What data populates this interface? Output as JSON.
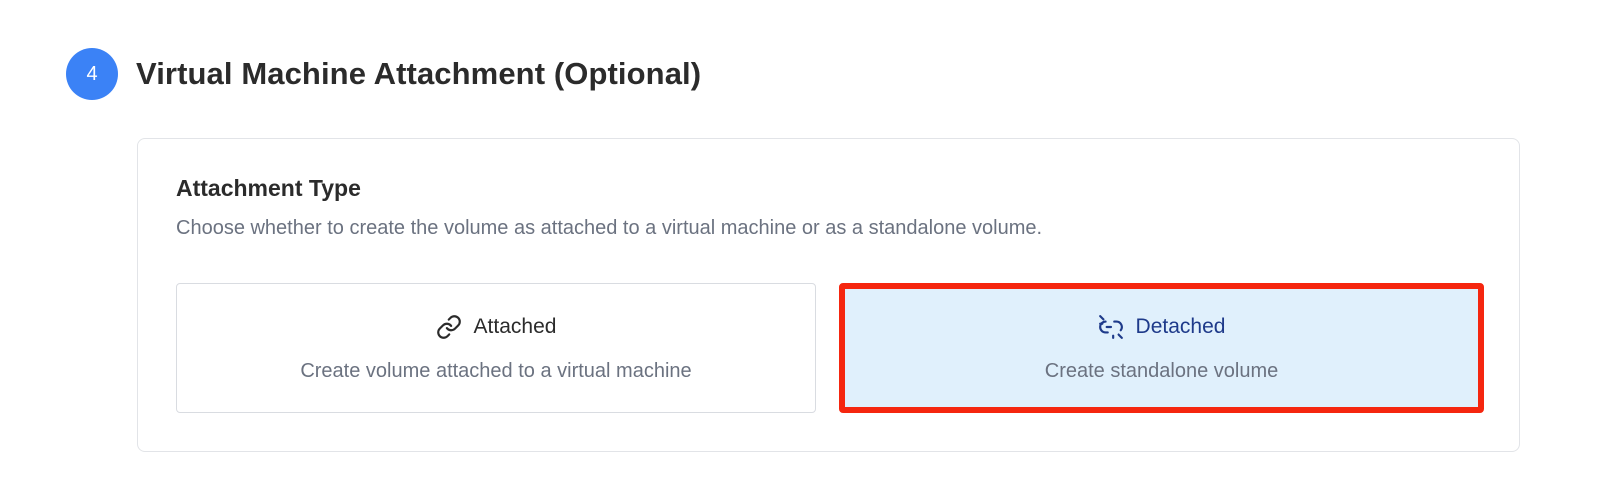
{
  "step": {
    "number": "4",
    "title": "Virtual Machine Attachment (Optional)"
  },
  "attachment": {
    "title": "Attachment Type",
    "description": "Choose whether to create the volume as attached to a virtual machine or as a standalone volume.",
    "options": [
      {
        "label": "Attached",
        "description": "Create volume attached to a virtual machine",
        "icon": "link-icon",
        "selected": false
      },
      {
        "label": "Detached",
        "description": "Create standalone volume",
        "icon": "unlink-icon",
        "selected": true
      }
    ]
  },
  "colors": {
    "badge": "#3b82f6",
    "selected_background": "#e0f0fc",
    "selected_border": "#f5260f",
    "selected_text": "#1e3a8a"
  }
}
